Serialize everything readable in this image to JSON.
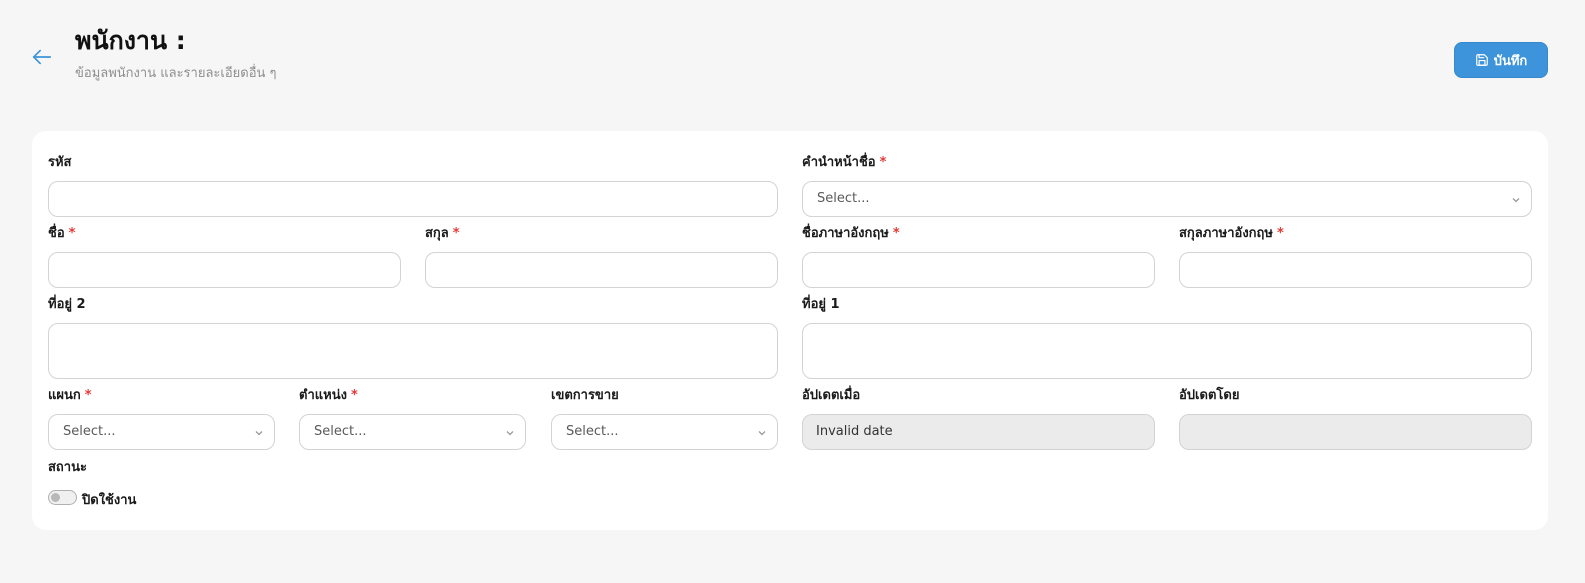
{
  "header": {
    "title": "พนักงาน :",
    "subtitle": "ข้อมูลพนักงาน และรายละเอียดอื่น ๆ",
    "save_label": "บันทึก",
    "back_icon": "arrow-left-icon",
    "save_icon": "floppy-disk-icon",
    "accent_color": "#3d94db"
  },
  "form": {
    "code": {
      "label": "รหัส",
      "value": ""
    },
    "prefix": {
      "label": "คำนำหน้าชื่อ",
      "required": "*",
      "placeholder": "Select..."
    },
    "first_name": {
      "label": "ชื่อ",
      "required": "*",
      "value": ""
    },
    "last_name": {
      "label": "สกุล",
      "required": "*",
      "value": ""
    },
    "first_name_en": {
      "label": "ชื่อภาษาอังกฤษ",
      "required": "*",
      "value": ""
    },
    "last_name_en": {
      "label": "สกุลภาษาอังกฤษ",
      "required": "*",
      "value": ""
    },
    "address2": {
      "label": "ที่อยู่ 2",
      "value": ""
    },
    "address1": {
      "label": "ที่อยู่ 1",
      "value": ""
    },
    "department": {
      "label": "แผนก",
      "required": "*",
      "placeholder": "Select..."
    },
    "position": {
      "label": "ตำแหน่ง",
      "required": "*",
      "placeholder": "Select..."
    },
    "sales_zone": {
      "label": "เขตการขาย",
      "placeholder": "Select..."
    },
    "updated_at": {
      "label": "อัปเดตเมื่อ",
      "value": "Invalid date"
    },
    "updated_by": {
      "label": "อัปเดตโดย",
      "value": ""
    },
    "status": {
      "label": "สถานะ",
      "toggle_label": "ปิดใช้งาน",
      "enabled": false
    }
  }
}
